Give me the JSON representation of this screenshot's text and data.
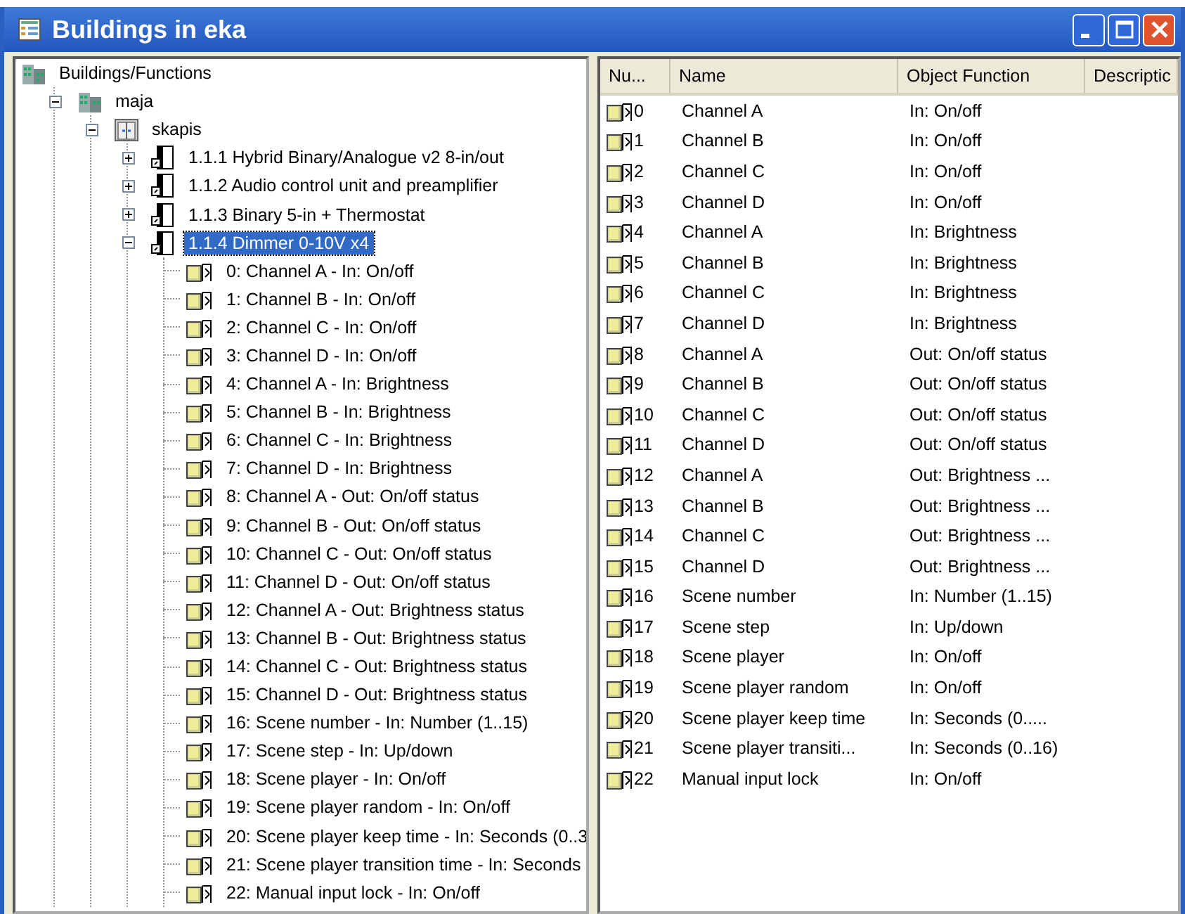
{
  "window": {
    "title": "Buildings in eka"
  },
  "tree": {
    "label": "Buildings/Functions",
    "kind": "root",
    "children": [
      {
        "label": "maja",
        "kind": "building",
        "expanded": true,
        "children": [
          {
            "label": "skapis",
            "kind": "room",
            "expanded": true,
            "children": [
              {
                "label": "1.1.1 Hybrid Binary/Analogue v2 8-in/out",
                "kind": "device",
                "expanded": false,
                "selected": false
              },
              {
                "label": "1.1.2 Audio control unit and preamplifier",
                "kind": "device",
                "expanded": false,
                "selected": false
              },
              {
                "label": "1.1.3 Binary 5-in + Thermostat",
                "kind": "device",
                "expanded": false,
                "selected": false
              },
              {
                "label": "1.1.4 Dimmer 0-10V x4",
                "kind": "device",
                "expanded": true,
                "selected": true,
                "children": [
                  {
                    "label": "0: Channel A - In: On/off",
                    "kind": "object",
                    "selected": false
                  },
                  {
                    "label": "1: Channel B - In: On/off",
                    "kind": "object",
                    "selected": false
                  },
                  {
                    "label": "2: Channel C - In: On/off",
                    "kind": "object",
                    "selected": false
                  },
                  {
                    "label": "3: Channel D - In: On/off",
                    "kind": "object",
                    "selected": false
                  },
                  {
                    "label": "4: Channel A - In: Brightness",
                    "kind": "object",
                    "selected": false
                  },
                  {
                    "label": "5: Channel B - In: Brightness",
                    "kind": "object",
                    "selected": false
                  },
                  {
                    "label": "6: Channel C - In: Brightness",
                    "kind": "object",
                    "selected": false
                  },
                  {
                    "label": "7: Channel D - In: Brightness",
                    "kind": "object",
                    "selected": false
                  },
                  {
                    "label": "8: Channel A - Out: On/off status",
                    "kind": "object",
                    "selected": false
                  },
                  {
                    "label": "9: Channel B - Out: On/off status",
                    "kind": "object",
                    "selected": false
                  },
                  {
                    "label": "10: Channel C - Out: On/off status",
                    "kind": "object",
                    "selected": false
                  },
                  {
                    "label": "11: Channel D - Out: On/off status",
                    "kind": "object",
                    "selected": false
                  },
                  {
                    "label": "12: Channel A - Out: Brightness status",
                    "kind": "object",
                    "selected": false
                  },
                  {
                    "label": "13: Channel B - Out: Brightness status",
                    "kind": "object",
                    "selected": false
                  },
                  {
                    "label": "14: Channel C - Out: Brightness status",
                    "kind": "object",
                    "selected": false
                  },
                  {
                    "label": "15: Channel D - Out: Brightness status",
                    "kind": "object",
                    "selected": false
                  },
                  {
                    "label": "16: Scene number - In: Number (1..15)",
                    "kind": "object",
                    "selected": false
                  },
                  {
                    "label": "17: Scene step - In: Up/down",
                    "kind": "object",
                    "selected": false
                  },
                  {
                    "label": "18: Scene player - In: On/off",
                    "kind": "object",
                    "selected": false
                  },
                  {
                    "label": "19: Scene player random - In: On/off",
                    "kind": "object",
                    "selected": false
                  },
                  {
                    "label": "20: Scene player keep time - In: Seconds (0..3",
                    "kind": "object",
                    "selected": false
                  },
                  {
                    "label": "21: Scene player transition time - In: Seconds",
                    "kind": "object",
                    "selected": false
                  },
                  {
                    "label": "22: Manual input lock - In: On/off",
                    "kind": "object",
                    "selected": false
                  }
                ]
              }
            ]
          }
        ]
      }
    ]
  },
  "table": {
    "columns": [
      "Nu...",
      "Name",
      "Object Function",
      "Descriptic"
    ],
    "rows": [
      [
        "0",
        "Channel A",
        "In: On/off"
      ],
      [
        "1",
        "Channel B",
        "In: On/off"
      ],
      [
        "2",
        "Channel C",
        "In: On/off"
      ],
      [
        "3",
        "Channel D",
        "In: On/off"
      ],
      [
        "4",
        "Channel A",
        "In: Brightness"
      ],
      [
        "5",
        "Channel B",
        "In: Brightness"
      ],
      [
        "6",
        "Channel C",
        "In: Brightness"
      ],
      [
        "7",
        "Channel D",
        "In: Brightness"
      ],
      [
        "8",
        "Channel A",
        "Out: On/off status"
      ],
      [
        "9",
        "Channel B",
        "Out: On/off status"
      ],
      [
        "10",
        "Channel C",
        "Out: On/off status"
      ],
      [
        "11",
        "Channel D",
        "Out: On/off status"
      ],
      [
        "12",
        "Channel A",
        "Out: Brightness ..."
      ],
      [
        "13",
        "Channel B",
        "Out: Brightness ..."
      ],
      [
        "14",
        "Channel C",
        "Out: Brightness ..."
      ],
      [
        "15",
        "Channel D",
        "Out: Brightness ..."
      ],
      [
        "16",
        "Scene number",
        "In: Number (1..15)"
      ],
      [
        "17",
        "Scene step",
        "In: Up/down"
      ],
      [
        "18",
        "Scene player",
        "In: On/off"
      ],
      [
        "19",
        "Scene player random",
        "In: On/off"
      ],
      [
        "20",
        "Scene player keep time",
        "In: Seconds (0....."
      ],
      [
        "21",
        "Scene player transiti...",
        "In: Seconds (0..16)"
      ],
      [
        "22",
        "Manual input lock",
        "In: On/off"
      ]
    ]
  }
}
